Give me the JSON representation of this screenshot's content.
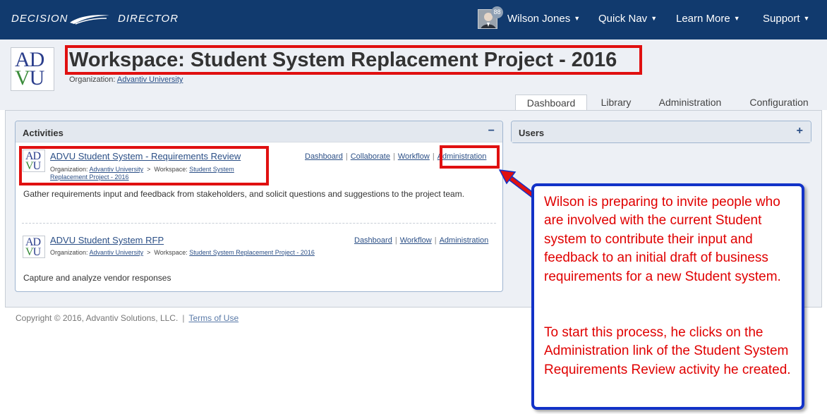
{
  "navbar": {
    "brand_left": "DECISION",
    "brand_right": "DIRECTOR",
    "avatar_badge": "88",
    "user_menu": "Wilson Jones",
    "quick_nav": "Quick Nav",
    "learn_more": "Learn More",
    "support": "Support",
    "bg_color": "#113a6e"
  },
  "workspace": {
    "logo_line1_a": "AD",
    "logo_line2_a": "V",
    "logo_line2_b": "U",
    "title": "Workspace: Student System Replacement Project - 2016",
    "org_label": "Organization:",
    "org_link": "Advantiv University"
  },
  "tabs": [
    "Dashboard",
    "Library",
    "Administration",
    "Configuration"
  ],
  "activities_panel": {
    "title": "Activities",
    "toggle": "−",
    "items": [
      {
        "title": "ADVU Student System - Requirements Review",
        "org_label": "Organization:",
        "org_link": "Advantiv University",
        "arrow": ">",
        "ws_label": "Workspace:",
        "ws_link": "Student System Replacement Project - 2016",
        "links": [
          "Dashboard",
          "Collaborate",
          "Workflow",
          "Administration"
        ],
        "description": "Gather requirements input and feedback from stakeholders, and solicit questions and suggestions to the project team."
      },
      {
        "title": "ADVU Student System RFP",
        "org_label": "Organization:",
        "org_link": "Advantiv University",
        "arrow": ">",
        "ws_label": "Workspace:",
        "ws_link": "Student System Replacement Project - 2016",
        "links": [
          "Dashboard",
          "Workflow",
          "Administration"
        ],
        "description": "Capture and analyze vendor responses"
      }
    ]
  },
  "users_panel": {
    "title": "Users",
    "toggle": "+"
  },
  "footer": {
    "copyright": "Copyright © 2016, Advantiv Solutions, LLC.",
    "sep": "|",
    "terms": "Terms of Use"
  },
  "callout": {
    "paragraph1": "Wilson is preparing to invite people who are involved with the current Student system to contribute their input and feedback to an initial draft of business requirements for a new Student system.",
    "paragraph2": "To start this process, he clicks on the Administration link of the Student System Requirements Review activity he created.",
    "text_color": "#e00000",
    "border_color": "#1232c8"
  },
  "highlight_color": "#e01010"
}
